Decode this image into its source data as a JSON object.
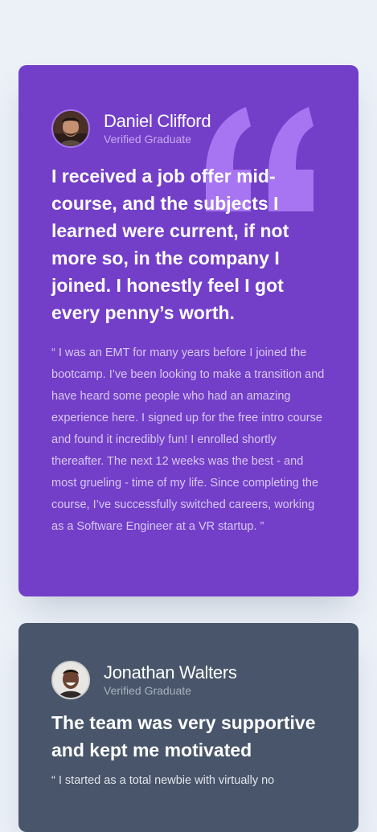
{
  "testimonials": [
    {
      "name": "Daniel Clifford",
      "badge": "Verified Graduate",
      "headline": "I received a job offer mid-course, and the subjects I learned were current, if not more so, in the company I joined. I honestly feel I got every penny’s worth.",
      "quote": "“ I was an EMT for many years before I joined the bootcamp. I’ve been looking to make a transition and have heard some people who had an amazing experience here. I signed up for the free intro course and found it incredibly fun! I enrolled shortly thereafter. The next 12 weeks was the best - and most grueling - time of my life. Since completing the course, I’ve successfully switched careers, working as a Software Engineer at a VR startup. ”",
      "accent_color": "#733fc8"
    },
    {
      "name": "Jonathan Walters",
      "badge": "Verified Graduate",
      "headline": "The team was very supportive and kept me motivated",
      "quote": "“ I started as a total newbie with virtually no",
      "accent_color": "#48556a"
    }
  ],
  "colors": {
    "page_background": "#ecf1f8",
    "quote_mark": "#a775f1"
  },
  "icons": {
    "quote_mark": "quotation-mark-icon"
  }
}
